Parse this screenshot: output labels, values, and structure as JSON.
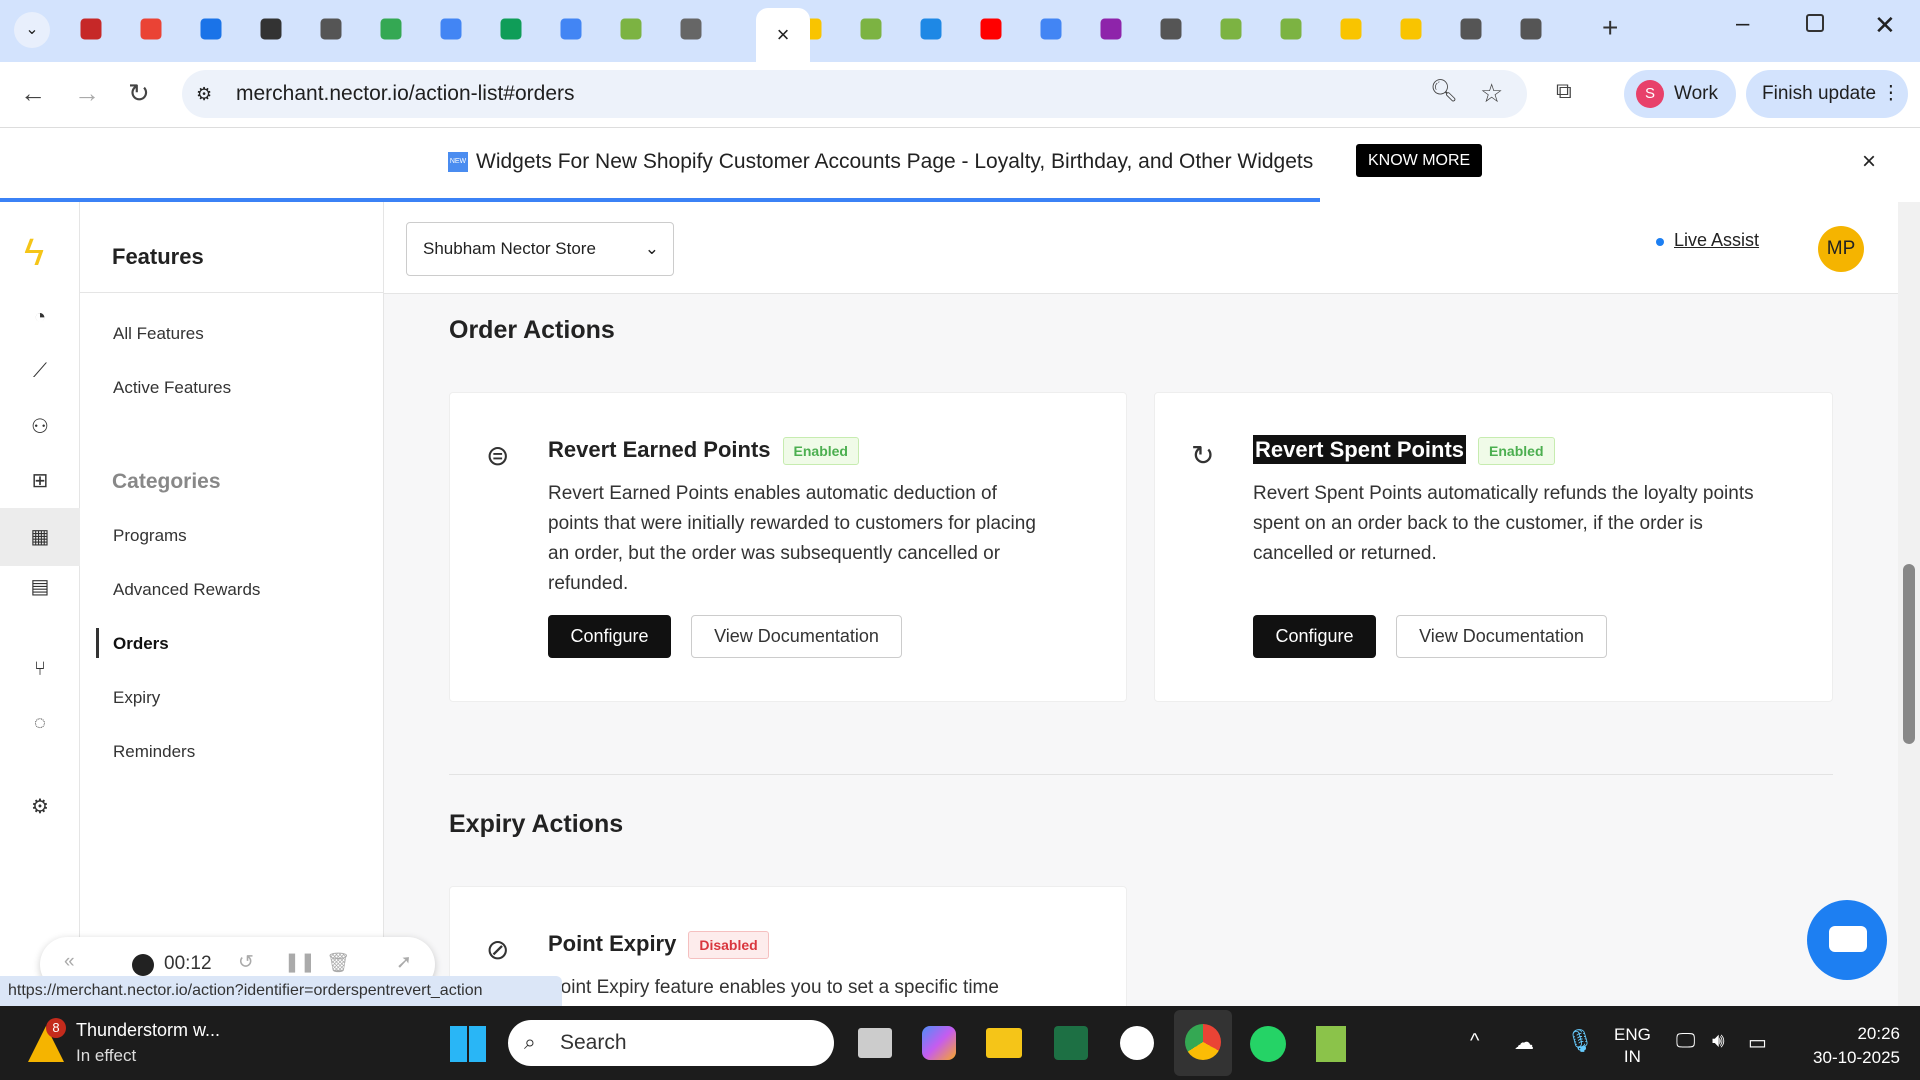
{
  "browser": {
    "url": "merchant.nector.io/action-list#orders",
    "profile_initial": "S",
    "profile_label": "Work",
    "update_label": "Finish update",
    "active_tab_close": "×",
    "new_tab": "+"
  },
  "banner": {
    "badge": "NEW",
    "text": "Widgets For New Shopify Customer Accounts Page - Loyalty, Birthday, and Other Widgets",
    "cta": "KNOW MORE",
    "close": "×"
  },
  "sidebar": {
    "title": "Features",
    "items": [
      "All Features",
      "Active Features"
    ],
    "categories_label": "Categories",
    "categories": [
      "Programs",
      "Advanced Rewards",
      "Orders",
      "Expiry",
      "Reminders"
    ],
    "active": "Orders"
  },
  "header": {
    "store": "Shubham Nector Store",
    "live_assist": "Live Assist",
    "avatar": "MP"
  },
  "sections": [
    {
      "title": "Order Actions",
      "cards": [
        {
          "title": "Revert Earned Points",
          "status": "Enabled",
          "desc": "Revert Earned Points enables automatic deduction of points that were initially rewarded to customers for placing an order, but the order was subsequently cancelled or refunded.",
          "configure": "Configure",
          "docs": "View Documentation"
        },
        {
          "title": "Revert Spent Points",
          "status": "Enabled",
          "desc": "Revert Spent Points automatically refunds the loyalty points spent on an order back to the customer, if the order is cancelled or returned.",
          "configure": "Configure",
          "docs": "View Documentation"
        }
      ]
    },
    {
      "title": "Expiry Actions",
      "cards": [
        {
          "title": "Point Expiry",
          "status": "Disabled",
          "desc": "Point Expiry feature enables you to set a specific time"
        }
      ]
    }
  ],
  "recorder": {
    "time": "00:12"
  },
  "status_url": "https://merchant.nector.io/action?identifier=orderspentrevert_action",
  "taskbar": {
    "weather_title": "Thunderstorm w...",
    "weather_sub": "In effect",
    "weather_badge": "8",
    "search": "Search",
    "lang1": "ENG",
    "lang2": "IN",
    "time": "20:26",
    "date": "30-10-2025"
  }
}
